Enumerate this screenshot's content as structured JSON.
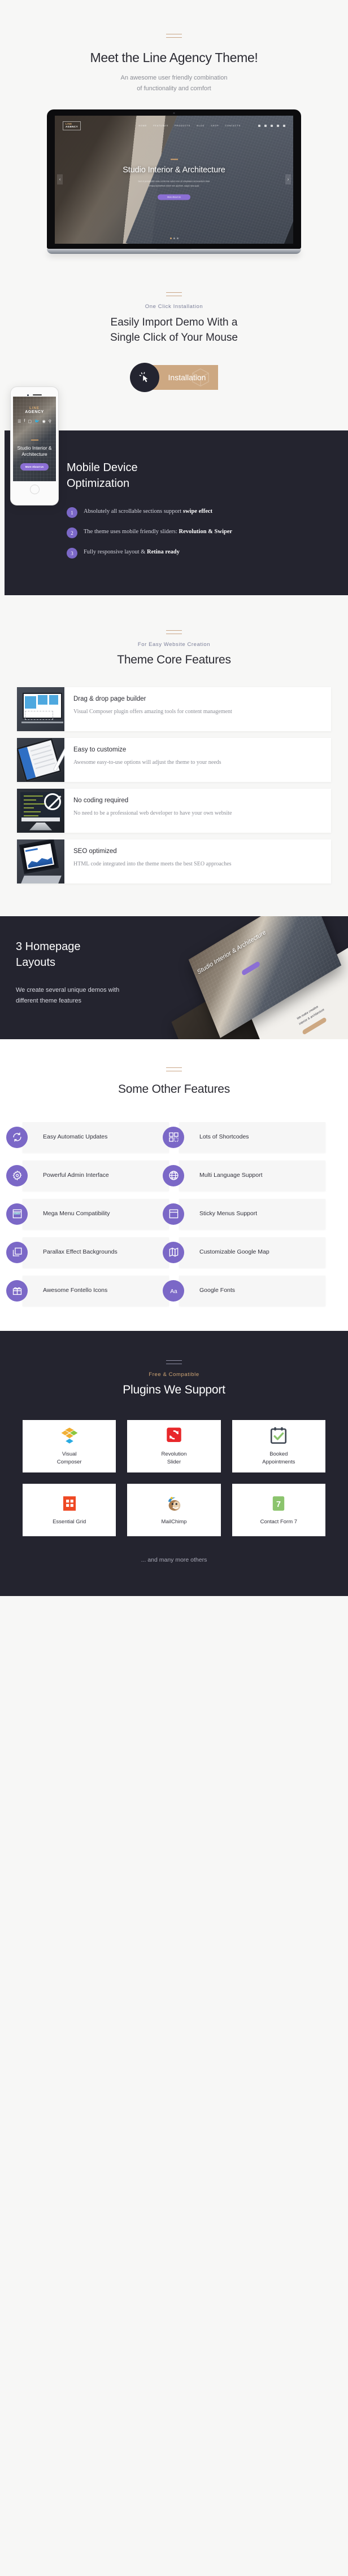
{
  "hero": {
    "title": "Meet the Line Agency Theme!",
    "subtitle_line1": "An awesome user friendly combination",
    "subtitle_line2": "of functionality and comfort"
  },
  "laptop_preview": {
    "logo_top": "LINE",
    "logo_bottom": "AGENCY",
    "nav": [
      "HOME",
      "FEATURES",
      "PRODUCTS",
      "BLOG",
      "SHOP",
      "CONTACTS"
    ],
    "social": [
      "facebook-icon",
      "instagram-icon",
      "twitter-icon",
      "linkedin-icon"
    ],
    "search": "search-icon",
    "headline": "Studio Interior & Architecture",
    "paragraph_line1": "Sed ut perspiciatis unde omnis iste natus error sit voluptatem accusantium dolor",
    "paragraph_line2": "emque laudantium totam rem aperiam, eaque ipsa quae",
    "button": "More About Us",
    "prev": "‹",
    "next": "›"
  },
  "installation": {
    "eyebrow": "One Click Installation",
    "title_line1": "Easily Import Demo With a",
    "title_line2": "Single Click of Your Mouse",
    "button_label": "Installation",
    "button_icon": "cursor-click-icon",
    "button_bg": "#cda882"
  },
  "mobile": {
    "title_line1": "Mobile Device",
    "title_line2": "Optimization",
    "items": [
      {
        "num": "1",
        "text": "Absolutely all scrollable sections support ",
        "bold": "swipe effect",
        "tail": ""
      },
      {
        "num": "2",
        "text": "The theme uses mobile friendly sliders: ",
        "bold": "Revolution & Swiper",
        "tail": ""
      },
      {
        "num": "3",
        "text": "Fully responsive layout & ",
        "bold": "Retina ready",
        "tail": ""
      }
    ],
    "phone_preview": {
      "logo_top": "LINE",
      "logo_bottom": "AGENCY",
      "headline_line1": "Studio Interior &",
      "headline_line2": "Architecture",
      "button": "More About Us",
      "icons": [
        "menu-icon",
        "facebook-icon",
        "instagram-icon",
        "twitter-icon",
        "dribbble-icon",
        "search-icon"
      ]
    },
    "accent": "#7b68c7"
  },
  "core_features": {
    "eyebrow": "For Easy Website Creation",
    "title": "Theme Core Features",
    "cards": [
      {
        "title": "Drag & drop page builder",
        "desc": "Visual Composer plugin offers amazing tools for content management",
        "thumb": "visual-composer-thumb"
      },
      {
        "title": "Easy to customize",
        "desc": "Awesome easy-to-use options will adjust the theme to your needs",
        "thumb": "tablet-stylus-thumb"
      },
      {
        "title": "No coding required",
        "desc": "No need to be a professional web developer to have your own website",
        "thumb": "no-code-thumb"
      },
      {
        "title": "SEO optimized",
        "desc": "HTML code integrated into the theme meets the best SEO approaches",
        "thumb": "seo-tablet-thumb"
      }
    ]
  },
  "layouts": {
    "title_line1": "3 Homepage",
    "title_line2": "Layouts",
    "desc": "We create several unique demos with different theme features",
    "preview_headline": "Studio Interior & Architecture",
    "preview_text_line1": "We make creative",
    "preview_text_line2": "interior & architecture"
  },
  "other_features": {
    "title": "Some Other Features",
    "items": [
      {
        "label": "Easy Automatic Updates",
        "icon": "refresh-icon"
      },
      {
        "label": "Lots of Shortcodes",
        "icon": "shortcodes-grid-icon"
      },
      {
        "label": "Powerful Admin Interface",
        "icon": "gear-icon"
      },
      {
        "label": "Multi Language Support",
        "icon": "globe-icon"
      },
      {
        "label": "Mega Menu Compatibility",
        "icon": "mega-menu-icon"
      },
      {
        "label": "Sticky Menus Support",
        "icon": "sticky-menu-icon"
      },
      {
        "label": "Parallax Effect Backgrounds",
        "icon": "layers-icon"
      },
      {
        "label": "Customizable Google Map",
        "icon": "map-icon"
      },
      {
        "label": "Awesome Fontello Icons",
        "icon": "gift-icon"
      },
      {
        "label": "Google Fonts",
        "icon": "typography-aa-icon"
      }
    ],
    "accent": "#7b68c7"
  },
  "plugins": {
    "eyebrow": "Free & Compatible",
    "title": "Plugins We Support",
    "items": [
      {
        "name_line1": "Visual",
        "name_line2": "Composer",
        "icon": "visual-composer-logo",
        "color": "#f0ad2e"
      },
      {
        "name_line1": "Revolution",
        "name_line2": "Slider",
        "icon": "revolution-slider-logo",
        "color": "#e8282b"
      },
      {
        "name_line1": "Booked",
        "name_line2": "Appointments",
        "icon": "booked-appointments-logo",
        "color": "#3c4450"
      },
      {
        "name_line1": "Essential Grid",
        "name_line2": "",
        "icon": "essential-grid-logo",
        "color": "#ef4823"
      },
      {
        "name_line1": "MailChimp",
        "name_line2": "",
        "icon": "mailchimp-logo",
        "color": "#8b6243"
      },
      {
        "name_line1": "Contact Form 7",
        "name_line2": "",
        "icon": "contact-form-7-logo",
        "color": "#8bc46d"
      }
    ],
    "footer_note": "... and many more others"
  }
}
